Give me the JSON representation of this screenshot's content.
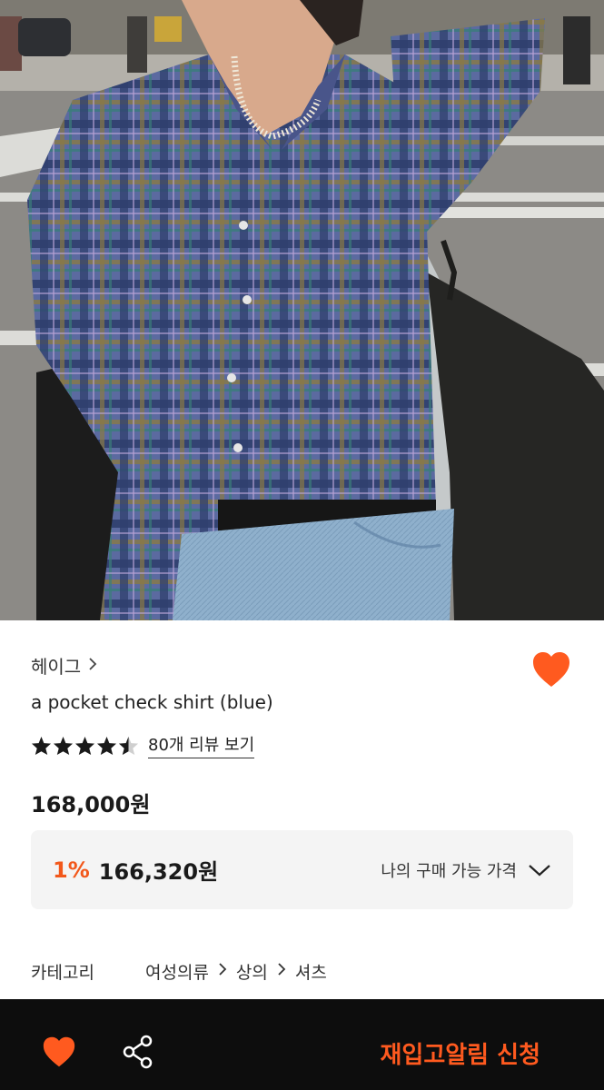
{
  "hero": {
    "image": "product-photo",
    "alt_icon": "product-image"
  },
  "product": {
    "brand": "헤이그",
    "name": "a pocket check shirt (blue)",
    "rating": 4.5,
    "review_link": "80개 리뷰 보기",
    "price": "168,000원",
    "discount_rate": "1%",
    "discount_price": "166,320원",
    "my_price_label": "나의 구매 가능 가격"
  },
  "category": {
    "label": "카테고리",
    "path": [
      "여성의류",
      "상의",
      "셔츠"
    ]
  },
  "bottom_bar": {
    "restock_label": "재입고알림 신청"
  },
  "colors": {
    "accent": "#FF5A1F",
    "bottom_bar_bg": "#0D0D0D",
    "price_box_bg": "#F4F4F4"
  },
  "icons": [
    "heart-icon",
    "chevron-right-icon",
    "star-icon",
    "chevron-down-icon",
    "share-icon"
  ]
}
